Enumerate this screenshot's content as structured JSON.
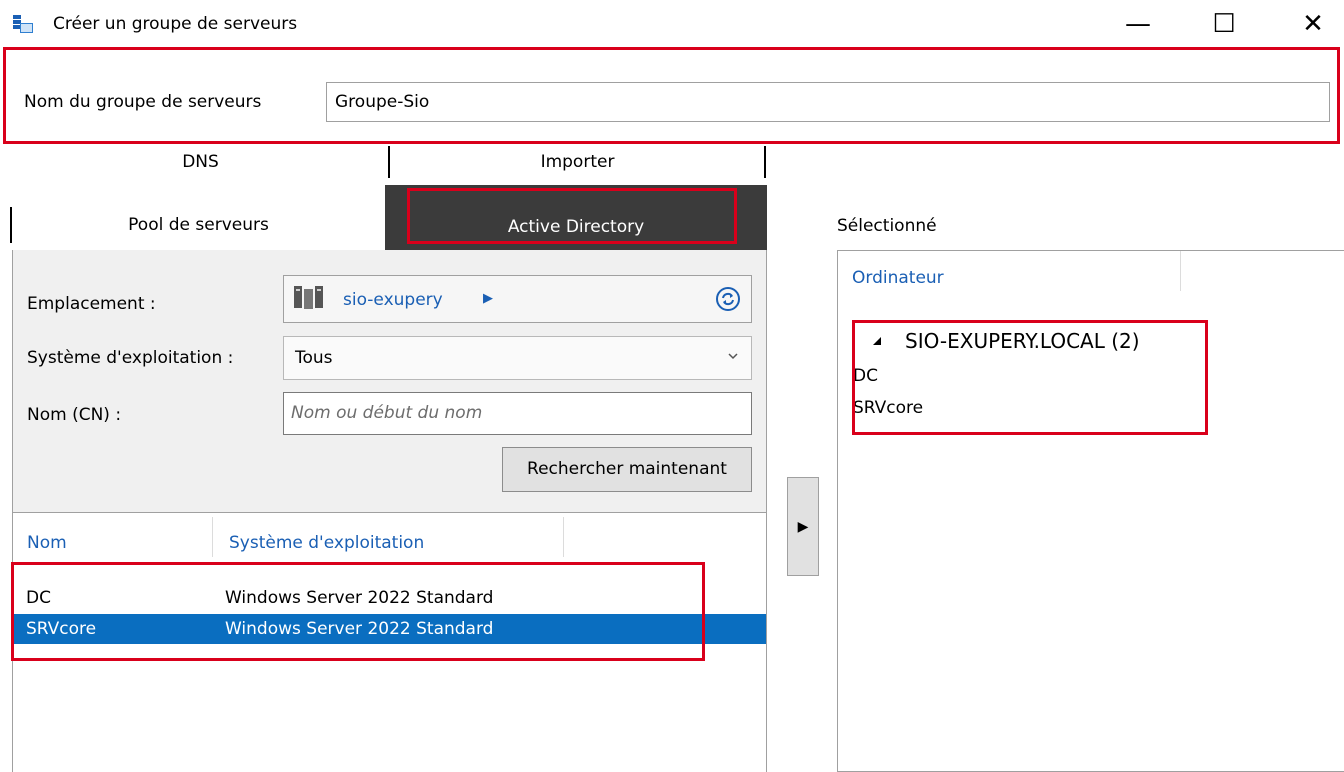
{
  "window": {
    "title": "Créer un groupe de serveurs",
    "controls": {
      "minimize": "—",
      "maximize": "☐",
      "close": "✕"
    }
  },
  "group_name": {
    "label": "Nom du groupe de serveurs",
    "value": "Groupe-Sio"
  },
  "tabs_top": [
    {
      "label": "DNS"
    },
    {
      "label": "Importer"
    }
  ],
  "tabs_main": [
    {
      "label": "Pool de serveurs",
      "active": false
    },
    {
      "label": "Active Directory",
      "active": true
    }
  ],
  "search": {
    "location_label": "Emplacement :",
    "location_value": "sio-exupery",
    "os_label": "Système d'exploitation :",
    "os_value": "Tous",
    "cn_label": "Nom (CN) :",
    "cn_placeholder": "Nom ou début du nom",
    "search_button": "Rechercher maintenant"
  },
  "results": {
    "columns": [
      "Nom",
      "Système d'exploitation"
    ],
    "rows": [
      {
        "name": "DC",
        "os": "Windows Server 2022 Standard",
        "selected": false
      },
      {
        "name": "SRVcore",
        "os": "Windows Server 2022 Standard",
        "selected": true
      }
    ]
  },
  "add_button": "▶",
  "selected": {
    "label": "Sélectionné",
    "column": "Ordinateur",
    "group_header": "SIO-EXUPERY.LOCAL (2)",
    "items": [
      "DC",
      "SRVcore"
    ]
  },
  "colors": {
    "accent": "#1a5fb4",
    "selection": "#0a6ec0",
    "highlight_box": "#d9001b",
    "active_tab": "#3b3b3b"
  }
}
